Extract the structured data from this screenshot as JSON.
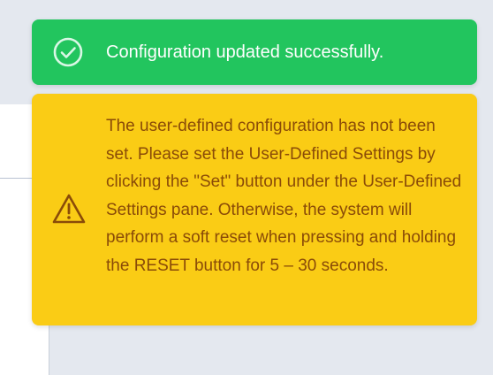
{
  "notifications": {
    "success": {
      "message": "Configuration updated successfully.",
      "icon": "check-circle-icon",
      "color": "#22c55e"
    },
    "warning": {
      "message": "The user-defined configuration has not been set. Please set the User-Defined Settings by clicking the \"Set\" button under the User-Defined Settings pane. Otherwise, the system will perform a soft reset when pressing and holding the RESET button for 5 – 30 seconds.",
      "icon": "warning-triangle-icon",
      "color": "#facc15",
      "text_color": "#8a4b08"
    }
  }
}
